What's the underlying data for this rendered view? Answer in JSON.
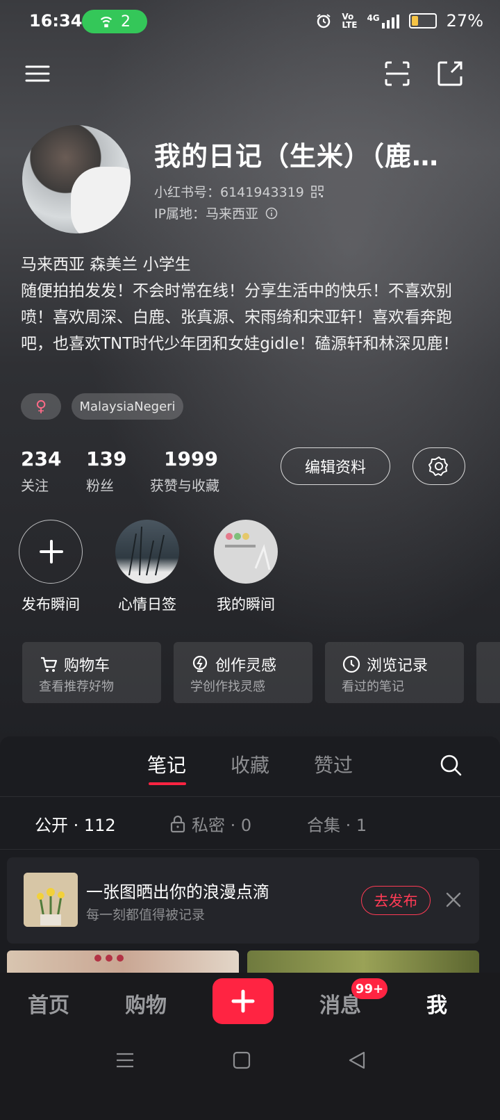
{
  "status_bar": {
    "time": "16:34",
    "hotspot_count": "2",
    "network": "4G",
    "battery_level": 0.27,
    "battery_text": "27%"
  },
  "top_nav": {
    "menu_icon": "menu-icon",
    "scan_icon": "scan-icon",
    "share_icon": "share-icon"
  },
  "profile": {
    "name": "我的日记（生米）（鹿…",
    "id_line": "小红书号：6141943319",
    "ip_line": "IP属地：马来西亚",
    "bio": "马来西亚 森美兰 小学生\n随便拍拍发发！不会时常在线！分享生活中的快乐！不喜欢别喷！喜欢周深、白鹿、张真源、宋雨绮和宋亚轩！喜欢看奔跑吧，也喜欢TNT时代少年团和女娃gidle！磕源轩和林深见鹿！",
    "gender_symbol": "♀",
    "location_tag": "MalaysiaNegeri"
  },
  "stats": [
    {
      "num": "234",
      "label": "关注"
    },
    {
      "num": "139",
      "label": "粉丝"
    },
    {
      "num": "1999",
      "label": "获赞与收藏"
    }
  ],
  "edit_button": "编辑资料",
  "moments": [
    {
      "label": "发布瞬间"
    },
    {
      "label": "心情日签"
    },
    {
      "label": "我的瞬间"
    }
  ],
  "cards": [
    {
      "title": "购物车",
      "subtitle": "查看推荐好物",
      "icon": "cart-icon"
    },
    {
      "title": "创作灵感",
      "subtitle": "学创作找灵感",
      "icon": "lightbulb-icon"
    },
    {
      "title": "浏览记录",
      "subtitle": "看过的笔记",
      "icon": "clock-icon"
    }
  ],
  "tabs": [
    {
      "label": "笔记",
      "active": true
    },
    {
      "label": "收藏",
      "active": false
    },
    {
      "label": "赞过",
      "active": false
    }
  ],
  "subtabs": {
    "public": "公开 · 112",
    "private": "私密 · 0",
    "collection": "合集 · 1"
  },
  "promo": {
    "title": "一张图晒出你的浪漫点滴",
    "subtitle": "每一刻都值得被记录",
    "button": "去发布"
  },
  "bottom_nav": {
    "home": "首页",
    "shop": "购物",
    "messages": "消息",
    "messages_badge": "99+",
    "me": "我"
  },
  "colors": {
    "accent": "#ff2442",
    "hotspot": "#34c759",
    "battery": "#f6c445"
  }
}
